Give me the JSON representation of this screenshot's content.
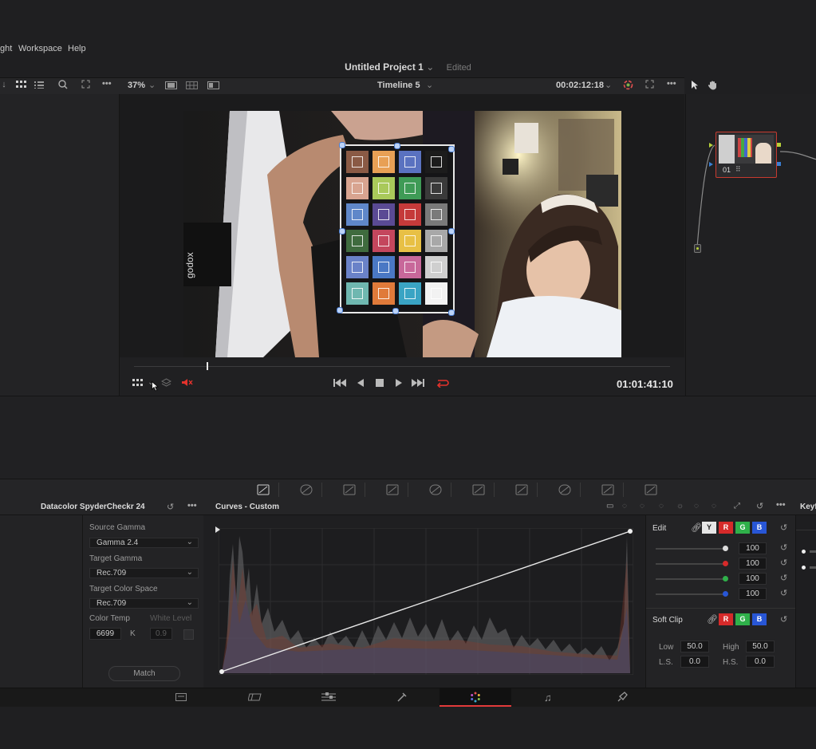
{
  "menu": {
    "items": [
      "ght",
      "Workspace",
      "Help"
    ]
  },
  "project": {
    "title": "Untitled Project 1",
    "status": "Edited"
  },
  "viewer_toolbar": {
    "zoom": "37%",
    "timeline": "Timeline 5",
    "timecode_top": "00:02:12:18"
  },
  "transport": {
    "timecode": "01:01:41:10"
  },
  "node": {
    "label": "01"
  },
  "palette_tools": [
    "curves-tool",
    "warper-tool",
    "qualifier-tool",
    "window-tool",
    "tracker-tool",
    "magic-mask-tool",
    "blur-tool",
    "key-tool",
    "sizing-tool",
    "3d-tool"
  ],
  "lut_panel": {
    "title": "Datacolor SpyderCheckr 24",
    "source_gamma_label": "Source Gamma",
    "source_gamma": "Gamma 2.4",
    "target_gamma_label": "Target Gamma",
    "target_gamma": "Rec.709",
    "target_cs_label": "Target Color Space",
    "target_cs": "Rec.709",
    "color_temp_label": "Color Temp",
    "white_level_label": "White Level",
    "color_temp": "6699",
    "k_label": "K",
    "white_level": "0.9",
    "match": "Match"
  },
  "curves": {
    "title": "Curves - Custom"
  },
  "edit_panel": {
    "title": "Edit",
    "channels": [
      "Y",
      "R",
      "G",
      "B"
    ],
    "values": [
      "100",
      "100",
      "100",
      "100"
    ],
    "soft_clip_label": "Soft Clip",
    "low_label": "Low",
    "low": "50.0",
    "high_label": "High",
    "high": "50.0",
    "ls_label": "L.S.",
    "ls": "0.0",
    "hs_label": "H.S.",
    "hs": "0.0"
  },
  "keyframes": {
    "title": "Keyf"
  },
  "colors": {
    "accent_red": "#e3322c",
    "node_border": "#c73a2f",
    "page_active": "#e23a3a"
  },
  "chart_checker": {
    "cells": [
      "#8a5a45",
      "#e8a055",
      "#5a72c0",
      "#1c1c1c",
      "#d8a490",
      "#a9c95a",
      "#3f9b56",
      "#3a3a3a",
      "#5f87c9",
      "#5a4a94",
      "#c53a3a",
      "#7a7a7a",
      "#3f6b3e",
      "#c4465d",
      "#e8c045",
      "#a8a8a8",
      "#6a82c8",
      "#4a78c4",
      "#c8689a",
      "#cfcfcf",
      "#6fb7b0",
      "#e07a3a",
      "#3aa4c4",
      "#f2f2f2"
    ]
  }
}
